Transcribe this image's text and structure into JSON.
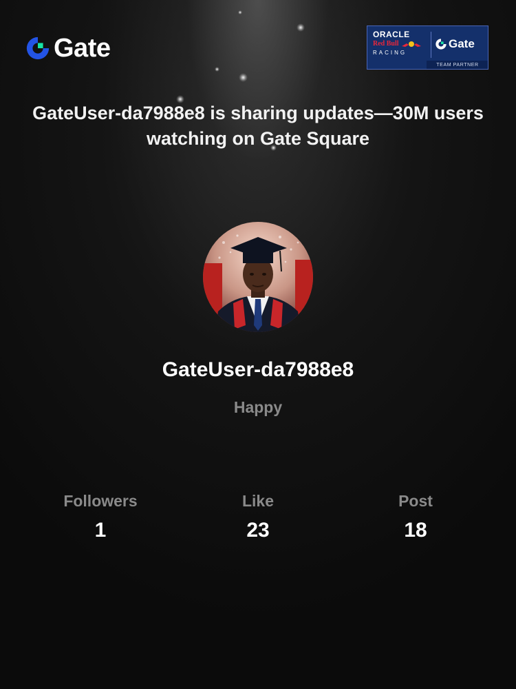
{
  "brand": {
    "name": "Gate",
    "icon": "gate-logo-icon",
    "accent": "#17e5a6",
    "primary": "#2354e6"
  },
  "partner_badge": {
    "oracle": "ORACLE",
    "red_bull": "Red Bull",
    "racing": "RACING",
    "gate": "Gate",
    "tag": "TEAM PARTNER",
    "background": "#14306b"
  },
  "headline": "GateUser-da7988e8 is sharing updates—30M users watching on Gate Square",
  "profile": {
    "avatar_icon": "profile-photo",
    "username": "GateUser-da7988e8",
    "bio": "Happy"
  },
  "stats": [
    {
      "label": "Followers",
      "value": "1"
    },
    {
      "label": "Like",
      "value": "23"
    },
    {
      "label": "Post",
      "value": "18"
    }
  ]
}
